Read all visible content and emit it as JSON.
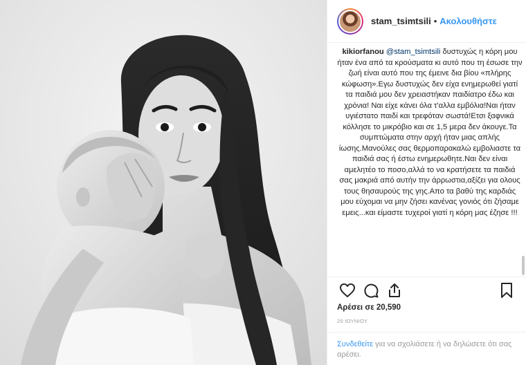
{
  "header": {
    "username": "stam_tsimtsili",
    "separator": "•",
    "follow_label": "Ακολουθήστε"
  },
  "comment": {
    "author": "kikiorfanou",
    "mention": "@stam_tsimtsili",
    "text": " δυστυχώς η κόρη μου ήταν ένα από τα κρούσματα κι αυτό που τη έσωσε την ζωή είναι αυτό που της έμεινε δια βίου «πλήρης κώφωση».Εγω δυστυχώς δεν είχα ενημερωθεί γιατί τα παιδιά μου δεν χρειαστήκαν παιδίατρο έδω και χρόνια! Ναι είχε κάνει όλα τ'αλλα εμβόλια!Ναι ήταν υγιέστατο παιδί και τρεφόταν σωστά!Ετσι ξαφνικά κόλλησε το μικρόβιο και σε 1,5 μερα δεν άκουγε.Τα συμπτώματα στην αρχή ήταν μιας απλής ίωσης.Μανούλες σας θερμοπαρακαλώ εμβολιαστε τα παιδιά σας ή έστω ενημερωθητε.Ναι δεν είναι αμελητέο το ποσο,αλλά το να κρατήσετε τα παιδιά σας μακριά από αυτήν την άρρωστια,αξίζει για ολους τους θησαυρούς της γης.Απο τα βαθύ της καρδιάς μου εύχομαι να μην ζήσει κανένας γονιός ότι ζήσαμε εμεις...και είμαστε τυχεροί γιατί η κόρη μας έζησε !!!"
  },
  "actions": {
    "icons": [
      "heart-icon",
      "comment-icon",
      "share-icon",
      "bookmark-icon"
    ]
  },
  "likes": {
    "label": "Αρέσει σε 20,590"
  },
  "date": {
    "label": "20 ΙΟΥΝΙΟΥ"
  },
  "login": {
    "link": "Συνδεθείτε",
    "text": " για να σχολιάσετε ή να δηλώσετε ότι σας αρέσει."
  },
  "colors": {
    "link_blue": "#3897f0",
    "mention_blue": "#003569",
    "text": "#262626",
    "muted": "#999999",
    "border": "#efefef"
  }
}
